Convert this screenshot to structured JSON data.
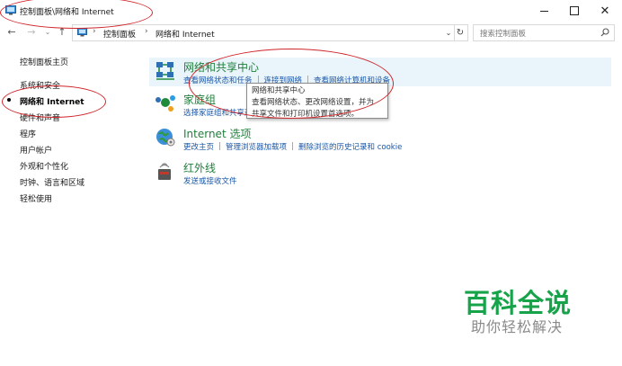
{
  "window": {
    "title": "控制面板\\网络和 Internet"
  },
  "address_bar": {
    "crumbs": [
      "控制面板",
      "网络和 Internet"
    ],
    "search_placeholder": "搜索控制面板"
  },
  "left_nav": {
    "home": "控制面板主页",
    "items": [
      {
        "label": "系统和安全",
        "current": false
      },
      {
        "label": "网络和 Internet",
        "current": true
      },
      {
        "label": "硬件和声音",
        "current": false
      },
      {
        "label": "程序",
        "current": false
      },
      {
        "label": "用户帐户",
        "current": false
      },
      {
        "label": "外观和个性化",
        "current": false
      },
      {
        "label": "时钟、语言和区域",
        "current": false
      },
      {
        "label": "轻松使用",
        "current": false
      }
    ]
  },
  "sections": [
    {
      "title": "网络和共享中心",
      "icon": "network-sharing-icon",
      "links": [
        "查看网络状态和任务",
        "连接到网络",
        "查看网络计算机和设备"
      ]
    },
    {
      "title": "家庭组",
      "icon": "homegroup-icon",
      "links": [
        "选择家庭组和共享选项"
      ]
    },
    {
      "title": "Internet 选项",
      "icon": "internet-options-icon",
      "links": [
        "更改主页",
        "管理浏览器加载项",
        "删除浏览的历史记录和 cookie"
      ]
    },
    {
      "title": "红外线",
      "icon": "infrared-icon",
      "links": [
        "发送或接收文件"
      ]
    }
  ],
  "tooltip": {
    "line1": "网络和共享中心",
    "line2": "查看网络状态、更改网络设置，并为",
    "line3": "共享文件和打印机设置首选项。"
  },
  "watermark": {
    "title": "百科全说",
    "subtitle": "助你轻松解决"
  },
  "colors": {
    "section_title": "#1f7f3b",
    "link": "#1a57a8",
    "annotation": "#d0252a",
    "watermark": "#16a34a"
  }
}
